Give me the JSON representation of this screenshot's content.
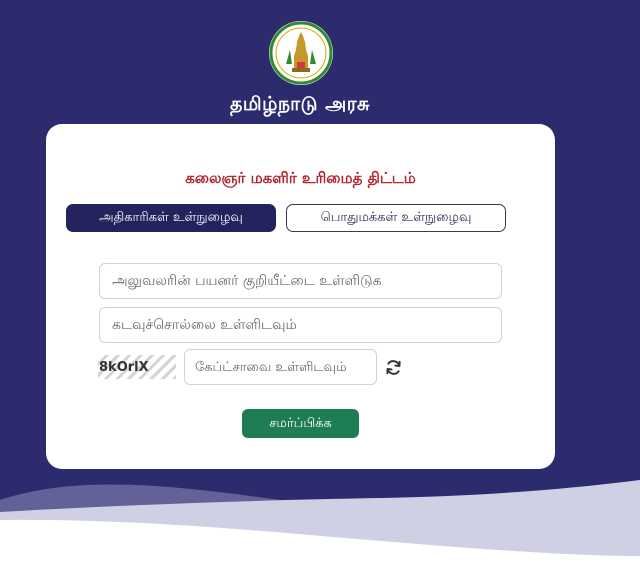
{
  "header": {
    "emblem_icon": "tamil-nadu-emblem-icon",
    "government_name": "தமிழ்நாடு அரசு"
  },
  "login_card": {
    "scheme_title": "கலைஞர் மகளிர் உரிமைத் திட்டம்",
    "tabs": [
      {
        "label": "அதிகாரிகள் உள்நுழைவு",
        "active": true
      },
      {
        "label": "பொதுமக்கள் உள்நுழைவு",
        "active": false
      }
    ],
    "username_placeholder": "அலுவலரின் பயனர் குறியீட்டை உள்ளிடுக",
    "password_placeholder": "கடவுச்சொல்லை உள்ளிடவும்",
    "captcha_text": "8kOrlX",
    "captcha_placeholder": "கேப்ட்சாவை உள்ளிடவும்",
    "refresh_icon": "refresh-icon",
    "submit_label": "சமர்ப்பிக்க"
  },
  "colors": {
    "background": "#2b2b6e",
    "title_red": "#b3262d",
    "active_tab": "#23235e",
    "submit_green": "#1e7d54"
  }
}
